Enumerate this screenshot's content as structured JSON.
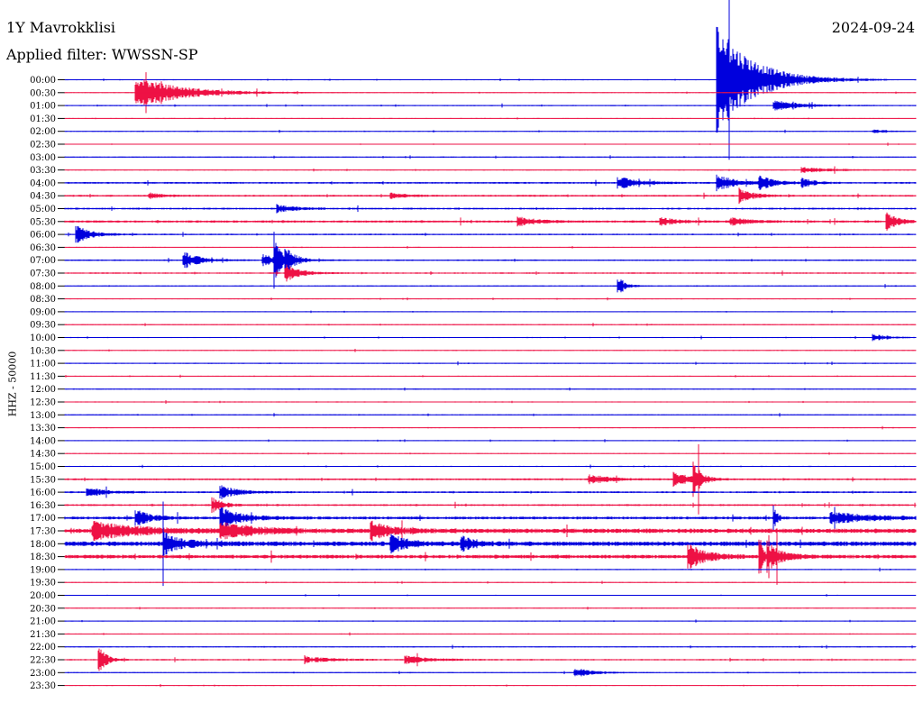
{
  "header": {
    "station": "1Y Mavrokklisi",
    "date": "2024-09-24",
    "filter_label": "Applied filter: WWSSN-SP",
    "channel_label": "HHZ - 50000"
  },
  "chart_data": {
    "type": "line",
    "title": "1Y Mavrokklisi",
    "subtitle": "Applied filter: WWSSN-SP",
    "date": "2024-09-24",
    "ylabel": "HHZ - 50000",
    "xlabel": "",
    "grid": false,
    "colors": [
      "#0000dd",
      "#ee1144"
    ],
    "rows": [
      "00:00",
      "00:30",
      "01:00",
      "01:30",
      "02:00",
      "02:30",
      "03:00",
      "03:30",
      "04:00",
      "04:30",
      "05:00",
      "05:30",
      "06:00",
      "06:30",
      "07:00",
      "07:30",
      "08:00",
      "08:30",
      "09:00",
      "09:30",
      "10:00",
      "10:30",
      "11:00",
      "11:30",
      "12:00",
      "12:30",
      "13:00",
      "13:30",
      "14:00",
      "14:30",
      "15:00",
      "15:30",
      "16:00",
      "16:30",
      "17:00",
      "17:30",
      "18:00",
      "18:30",
      "19:00",
      "19:30",
      "20:00",
      "20:30",
      "21:00",
      "21:30",
      "22:00",
      "22:30",
      "23:00",
      "23:30"
    ],
    "row_minutes": 30,
    "noise_level": [
      0.6,
      0.5,
      0.6,
      0.5,
      0.5,
      0.5,
      0.6,
      0.6,
      1.0,
      1.0,
      1.0,
      1.2,
      0.8,
      0.5,
      0.8,
      0.8,
      0.6,
      0.5,
      0.5,
      0.6,
      0.6,
      0.5,
      0.6,
      0.5,
      0.6,
      0.6,
      0.6,
      0.5,
      0.5,
      0.5,
      0.6,
      1.0,
      1.0,
      1.0,
      1.5,
      2.5,
      2.5,
      2.0,
      0.6,
      0.5,
      0.5,
      0.5,
      0.5,
      0.5,
      0.6,
      0.8,
      0.6,
      0.5
    ],
    "events": [
      {
        "row": "00:00",
        "minute": 23.0,
        "amp": 62,
        "dur": 2.0
      },
      {
        "row": "00:30",
        "minute": 2.5,
        "amp": 18,
        "dur": 2.5
      },
      {
        "row": "01:00",
        "minute": 25.0,
        "amp": 6,
        "dur": 1.5
      },
      {
        "row": "02:00",
        "minute": 28.5,
        "amp": 2,
        "dur": 0.8
      },
      {
        "row": "03:30",
        "minute": 26.0,
        "amp": 3,
        "dur": 1.5
      },
      {
        "row": "04:00",
        "minute": 19.5,
        "amp": 7,
        "dur": 1.0
      },
      {
        "row": "04:00",
        "minute": 23.0,
        "amp": 8,
        "dur": 1.2
      },
      {
        "row": "04:00",
        "minute": 24.5,
        "amp": 7,
        "dur": 0.8
      },
      {
        "row": "04:00",
        "minute": 26.0,
        "amp": 5,
        "dur": 0.6
      },
      {
        "row": "04:30",
        "minute": 3.0,
        "amp": 3,
        "dur": 0.8
      },
      {
        "row": "04:30",
        "minute": 11.5,
        "amp": 3,
        "dur": 0.8
      },
      {
        "row": "04:30",
        "minute": 23.8,
        "amp": 8,
        "dur": 0.7
      },
      {
        "row": "05:00",
        "minute": 7.5,
        "amp": 4,
        "dur": 1.0
      },
      {
        "row": "05:30",
        "minute": 16.0,
        "amp": 5,
        "dur": 1.0
      },
      {
        "row": "05:30",
        "minute": 21.0,
        "amp": 4,
        "dur": 1.0
      },
      {
        "row": "05:30",
        "minute": 23.5,
        "amp": 4,
        "dur": 1.0
      },
      {
        "row": "05:30",
        "minute": 29.0,
        "amp": 9,
        "dur": 0.6
      },
      {
        "row": "06:00",
        "minute": 0.4,
        "amp": 10,
        "dur": 0.8
      },
      {
        "row": "07:00",
        "minute": 4.2,
        "amp": 10,
        "dur": 0.8
      },
      {
        "row": "07:00",
        "minute": 7.0,
        "amp": 6,
        "dur": 1.0
      },
      {
        "row": "07:00",
        "minute": 7.8,
        "amp": 10,
        "dur": 0.6
      },
      {
        "row": "07:00",
        "minute": 7.4,
        "amp": 24,
        "dur": 0.3
      },
      {
        "row": "07:30",
        "minute": 7.8,
        "amp": 9,
        "dur": 0.8
      },
      {
        "row": "08:00",
        "minute": 19.5,
        "amp": 10,
        "dur": 0.4
      },
      {
        "row": "10:00",
        "minute": 28.5,
        "amp": 4,
        "dur": 0.8
      },
      {
        "row": "15:30",
        "minute": 18.5,
        "amp": 5,
        "dur": 1.2
      },
      {
        "row": "15:30",
        "minute": 21.5,
        "amp": 9,
        "dur": 0.8
      },
      {
        "row": "15:30",
        "minute": 22.2,
        "amp": 16,
        "dur": 0.4
      },
      {
        "row": "16:00",
        "minute": 0.8,
        "amp": 5,
        "dur": 1.0
      },
      {
        "row": "16:00",
        "minute": 5.5,
        "amp": 7,
        "dur": 1.0
      },
      {
        "row": "16:30",
        "minute": 5.2,
        "amp": 8,
        "dur": 0.6
      },
      {
        "row": "17:00",
        "minute": 2.5,
        "amp": 9,
        "dur": 0.8
      },
      {
        "row": "17:00",
        "minute": 5.5,
        "amp": 11,
        "dur": 1.2
      },
      {
        "row": "17:00",
        "minute": 27.0,
        "amp": 6,
        "dur": 2.5
      },
      {
        "row": "17:00",
        "minute": 25.0,
        "amp": 12,
        "dur": 0.2
      },
      {
        "row": "17:30",
        "minute": 1.0,
        "amp": 9,
        "dur": 2.5
      },
      {
        "row": "17:30",
        "minute": 5.5,
        "amp": 11,
        "dur": 1.5
      },
      {
        "row": "17:30",
        "minute": 10.8,
        "amp": 10,
        "dur": 1.0
      },
      {
        "row": "18:00",
        "minute": 3.5,
        "amp": 11,
        "dur": 1.0
      },
      {
        "row": "18:00",
        "minute": 11.5,
        "amp": 9,
        "dur": 1.0
      },
      {
        "row": "18:00",
        "minute": 14.0,
        "amp": 8,
        "dur": 0.6
      },
      {
        "row": "18:30",
        "minute": 22.0,
        "amp": 13,
        "dur": 1.0
      },
      {
        "row": "18:30",
        "minute": 24.8,
        "amp": 13,
        "dur": 0.8
      },
      {
        "row": "18:30",
        "minute": 24.5,
        "amp": 26,
        "dur": 0.2
      },
      {
        "row": "22:30",
        "minute": 1.2,
        "amp": 16,
        "dur": 0.4
      },
      {
        "row": "22:30",
        "minute": 8.5,
        "amp": 3,
        "dur": 1.5
      },
      {
        "row": "22:30",
        "minute": 12.0,
        "amp": 4,
        "dur": 1.5
      },
      {
        "row": "23:00",
        "minute": 18.0,
        "amp": 5,
        "dur": 1.0
      }
    ]
  }
}
